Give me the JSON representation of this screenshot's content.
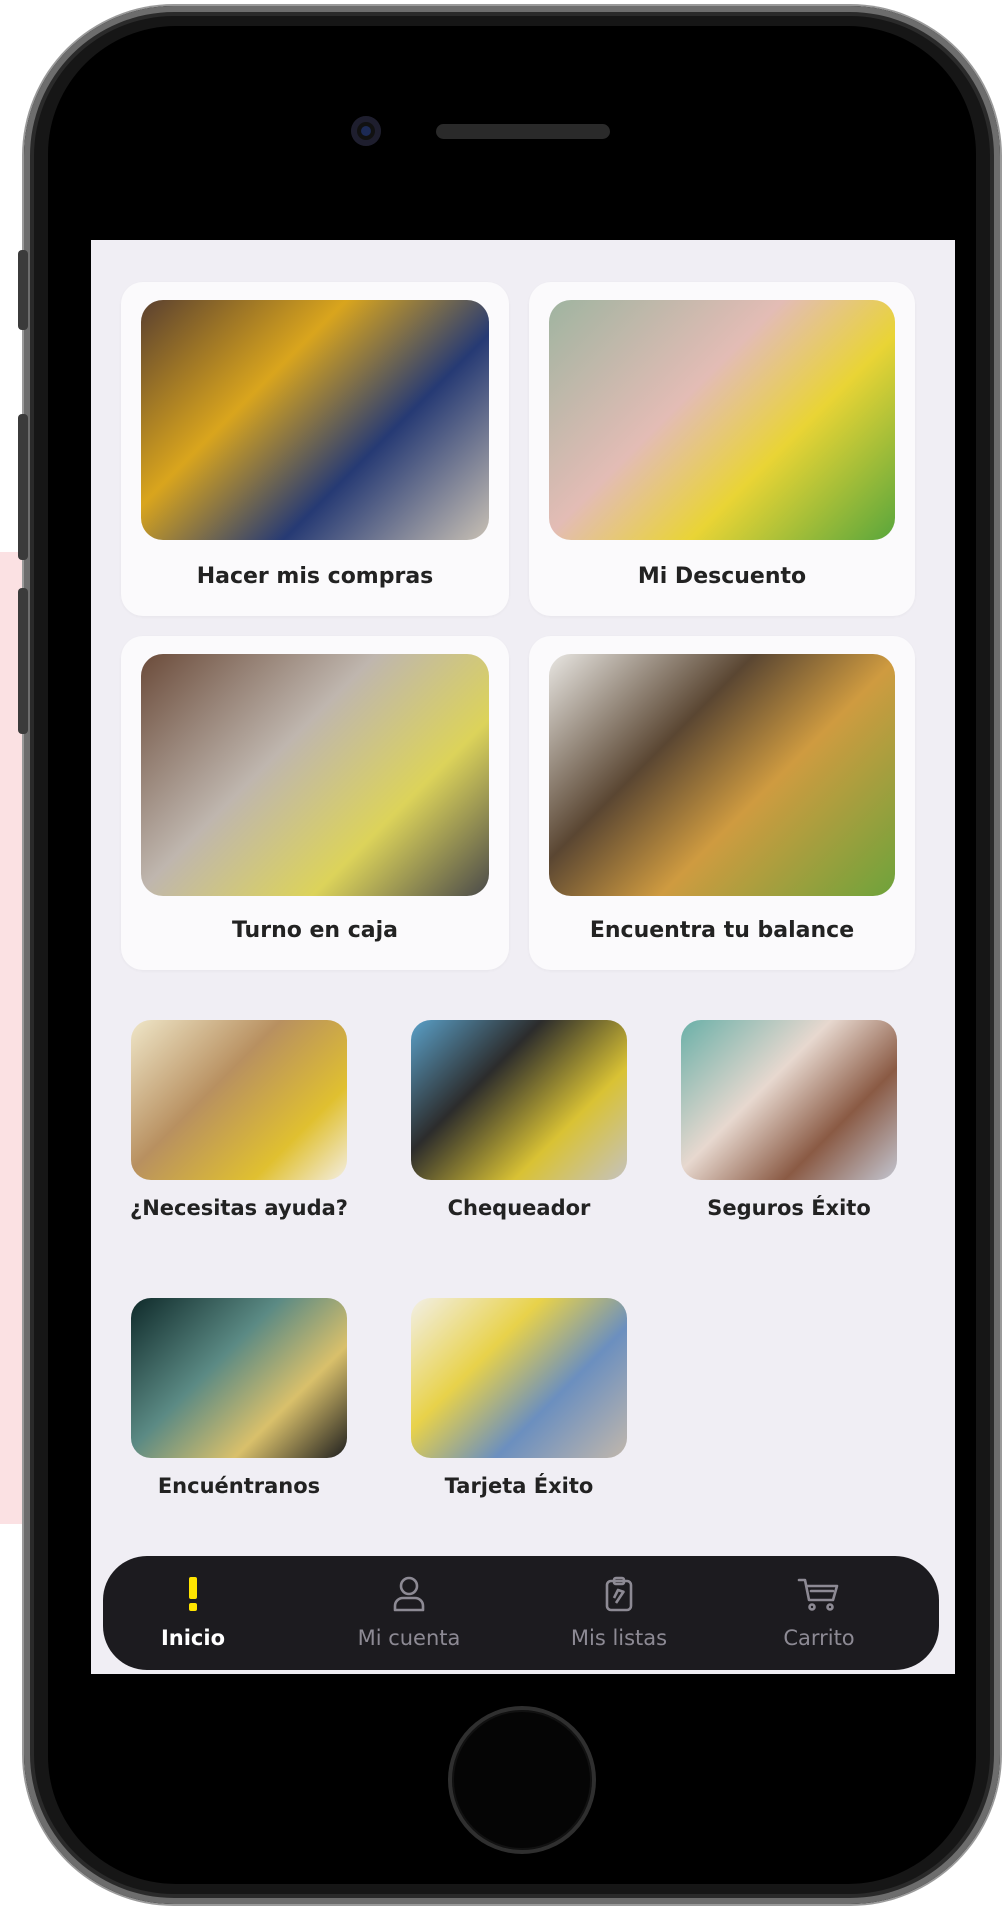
{
  "tiles_large": [
    {
      "label": "Hacer mis compras",
      "icon": "couple-shopping-photo"
    },
    {
      "label": "Mi Descuento",
      "icon": "supermarket-cart-photo"
    },
    {
      "label": "Turno en caja",
      "icon": "woman-phone-photo"
    },
    {
      "label": "Encuentra tu balance",
      "icon": "kitchen-family-photo"
    }
  ],
  "tiles_small": [
    {
      "label": "¿Necesitas ayuda?",
      "icon": "support-agent-photo"
    },
    {
      "label": "Chequeador",
      "icon": "price-checker-photo"
    },
    {
      "label": "Seguros Éxito",
      "icon": "family-insurance-photo"
    },
    {
      "label": "Encuéntranos",
      "icon": "car-driver-photo"
    },
    {
      "label": "Tarjeta Éxito",
      "icon": "credit-card-photo"
    }
  ],
  "nav": {
    "items": [
      {
        "label": "Inicio",
        "icon": "exclamation-icon",
        "active": true
      },
      {
        "label": "Mi cuenta",
        "icon": "user-icon",
        "active": false
      },
      {
        "label": "Mis listas",
        "icon": "list-clipboard-icon",
        "active": false
      },
      {
        "label": "Carrito",
        "icon": "cart-icon",
        "active": false
      }
    ],
    "active_color": "#ffe400",
    "bar_color": "#1c1b1f"
  }
}
